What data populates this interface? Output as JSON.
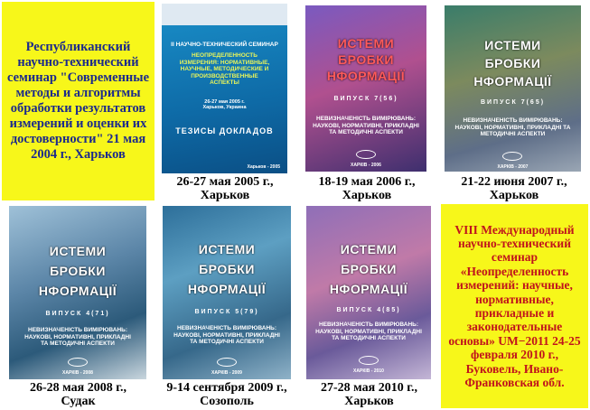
{
  "intro_text": "Республиканский научно-технический семинар \"Современные методы и алгоритмы обработки результатов измерений и оценки их достоверности\" 21 мая 2004 г., Харьков",
  "final_text": "VIII Международный научно-технический семинар «Неопределенность измерений: научные, нормативные, прикладные и законодательные основы» UM−2011 24-25 февраля 2010 г., Буковель, Ивано-Франковская обл.",
  "first_cover": {
    "header": "II НАУЧНО-ТЕХНИЧЕСКИЙ СЕМИНАР",
    "title": "НЕОПРЕДЕЛЕННОСТЬ ИЗМЕРЕНИЯ: НОРМАТИВНЫЕ, НАУЧНЫЕ, МЕТОДИЧЕСКИЕ И ПРОИЗВОДСТВЕННЫЕ АСПЕКТЫ",
    "dates": "26-27 мая 2005 г. Харьков, Украина",
    "thesis": "ТЕЗИСЫ ДОКЛАДОВ",
    "footer": "Харьков - 2005",
    "caption_line1": "26-27 мая 2005 г.,",
    "caption_line2": "Харьков"
  },
  "journal": {
    "word1": "ИСТЕМИ",
    "word2": "БРОБКИ",
    "word3": "НФОРМАЦІЇ",
    "subtitle": "НЕВИЗНАЧЕНІСТЬ ВИМІРЮВАНЬ: НАУКОВІ, НОРМАТИВНІ, ПРИКЛАДНІ ТА МЕТОДИЧНІ АСПЕКТИ"
  },
  "covers": [
    {
      "issue": "ВИПУСК 7(56)",
      "year": "ХАРКІВ - 2006",
      "caption_line1": "18-19 мая 2006 г.,",
      "caption_line2": "Харьков"
    },
    {
      "issue": "ВИПУСК 7(65)",
      "year": "ХАРКІВ - 2007",
      "caption_line1": "21-22 июня 2007 г.,",
      "caption_line2": "Харьков"
    },
    {
      "issue": "ВИПУСК 4(71)",
      "year": "ХАРКІВ - 2008",
      "caption_line1": "26-28 мая 2008 г.,",
      "caption_line2": "Судак"
    },
    {
      "issue": "ВИПУСК 5(79)",
      "year": "ХАРКІВ - 2009",
      "caption_line1": "9-14 сентября 2009 г.,",
      "caption_line2": "Созополь"
    },
    {
      "issue": "ВИПУСК 4(85)",
      "year": "ХАРКІВ - 2010",
      "caption_line1": "27-28 мая 2010 г.,",
      "caption_line2": "Харьков"
    }
  ],
  "colors": {
    "intro_text": "#1c2a8c",
    "final_text": "#c0141c",
    "panel_background": "#f7f71a"
  }
}
